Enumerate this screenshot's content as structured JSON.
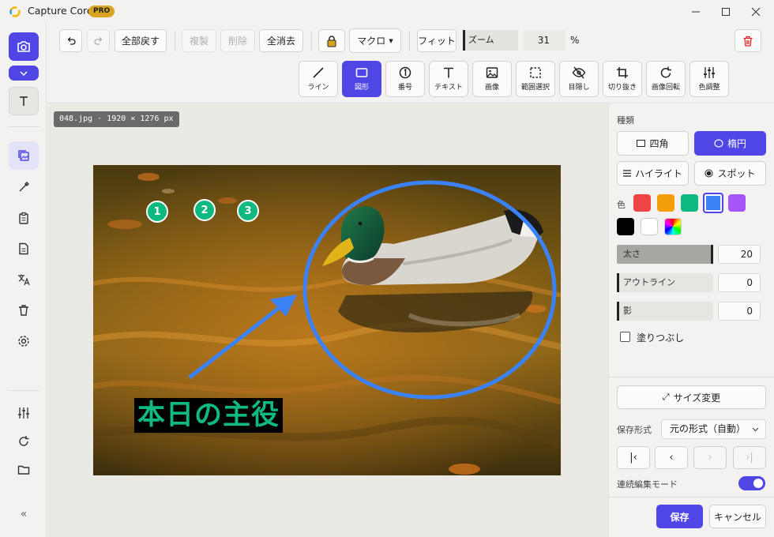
{
  "app": {
    "title": "Capture Core",
    "badge": "PRO"
  },
  "toolbar": {
    "undo_icon": "undo-icon",
    "redo_icon": "redo-icon",
    "revert_all": "全部戻す",
    "duplicate": "複製",
    "delete": "削除",
    "clear_all": "全消去",
    "macro": "マクロ",
    "fit": "フィット",
    "zoom_label": "ズーム",
    "zoom_value": "31",
    "zoom_unit": "%",
    "tools": [
      {
        "label": "ライン",
        "icon": "line-icon"
      },
      {
        "label": "図形",
        "icon": "rectangle-icon"
      },
      {
        "label": "番号",
        "icon": "number-icon"
      },
      {
        "label": "テキスト",
        "icon": "text-icon"
      },
      {
        "label": "画像",
        "icon": "image-icon"
      },
      {
        "label": "範囲選択",
        "icon": "selection-icon"
      },
      {
        "label": "目隠し",
        "icon": "eye-slash-icon"
      },
      {
        "label": "切り抜き",
        "icon": "crop-icon"
      },
      {
        "label": "画像回転",
        "icon": "rotate-icon"
      },
      {
        "label": "色調整",
        "icon": "sliders-icon"
      }
    ],
    "active_tool": "図形"
  },
  "canvas": {
    "file_info": "048.jpg · 1920 × 1276 px",
    "numbers": [
      "1",
      "2",
      "3"
    ],
    "caption": "本日の主役",
    "accent_color": "#3b82f6",
    "number_color": "#10b981"
  },
  "panel": {
    "section": "種類",
    "shapes": [
      "四角",
      "楕円",
      "ハイライト",
      "スポット"
    ],
    "active_shape": "楕円",
    "color_label": "色",
    "colors": [
      "#ef4444",
      "#f59e0b",
      "#10b981",
      "#3b82f6",
      "#a855f7",
      "#000000",
      "#ffffff",
      "rainbow"
    ],
    "selected_color": "#3b82f6",
    "thickness": {
      "label": "太さ",
      "value": "20",
      "level": 0.9
    },
    "outline": {
      "label": "アウトライン",
      "value": "0",
      "level": 0
    },
    "shadow": {
      "label": "影",
      "value": "0",
      "level": 0
    },
    "fill": {
      "label": "塗りつぶし",
      "checked": false
    },
    "resize": "サイズ変更",
    "save_format_label": "保存形式",
    "save_format": "元の形式（自動）",
    "continuous_mode": "連続編集モード",
    "continuous_on": true,
    "save": "保存",
    "cancel": "キャンセル"
  },
  "brand_color": "#4f46e5"
}
